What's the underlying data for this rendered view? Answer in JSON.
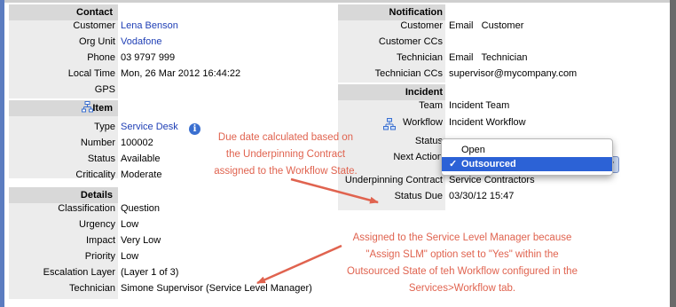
{
  "contact": {
    "header": "Contact",
    "customer_label": "Customer",
    "customer": "Lena Benson",
    "org_unit_label": "Org Unit",
    "org_unit": "Vodafone",
    "phone_label": "Phone",
    "phone": "03 9797 999",
    "local_time_label": "Local Time",
    "local_time": "Mon, 26 Mar 2012 16:44:22",
    "gps_label": "GPS",
    "gps": ""
  },
  "item": {
    "header": "Item",
    "type_label": "Type",
    "type": "Service Desk",
    "number_label": "Number",
    "number": "100002",
    "status_label": "Status",
    "status": "Available",
    "criticality_label": "Criticality",
    "criticality": "Moderate"
  },
  "details": {
    "header": "Details",
    "classification_label": "Classification",
    "classification": "Question",
    "urgency_label": "Urgency",
    "urgency": "Low",
    "impact_label": "Impact",
    "impact": "Very Low",
    "priority_label": "Priority",
    "priority": "Low",
    "escalation_label": "Escalation Layer",
    "escalation": "(Layer 1 of 3)",
    "technician_label": "Technician",
    "technician": "Simone Supervisor (Service Level Manager)"
  },
  "notification": {
    "header": "Notification",
    "customer_label": "Customer",
    "customer": "Email   Customer",
    "customer_ccs_label": "Customer CCs",
    "customer_ccs": "",
    "technician_label": "Technician",
    "technician": "Email   Technician",
    "technician_ccs_label": "Technician CCs",
    "technician_ccs": "supervisor@mycompany.com"
  },
  "incident": {
    "header": "Incident",
    "team_label": "Team",
    "team": "Incident Team",
    "workflow_label": "Workflow",
    "workflow": "Incident Workflow",
    "status_label": "Status",
    "next_action_label": "Next Action",
    "underpinning_label": "Underpinning Contract",
    "underpinning": "Service Contractors",
    "status_due_label": "Status Due",
    "status_due": "03/30/12 15:47"
  },
  "dropdown": {
    "options": [
      "Open",
      "Outsourced"
    ],
    "selected": "Outsourced",
    "check": "✓"
  },
  "annotations": {
    "due_date": [
      "Due date calculated based on",
      "the Underpinning Contract",
      "assigned to the Workflow State."
    ],
    "slm": [
      "Assigned to the Service Level Manager because",
      "\"Assign SLM\" option set to \"Yes\" within the",
      "Outsourced State of teh Workflow configured in the",
      "Services>Workflow tab."
    ]
  },
  "colors": {
    "link": "#1f3fb5",
    "annotation": "#e0634f",
    "section_bg": "#d8d8d8",
    "selected": "#2c62d6"
  }
}
